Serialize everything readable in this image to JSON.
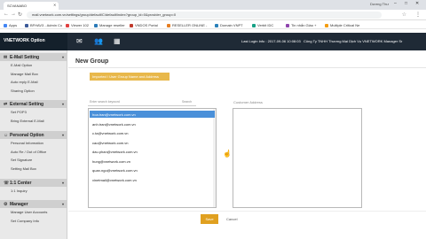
{
  "browser": {
    "tab_title": "SCVANABO",
    "tab_close": "✕",
    "profile_name": "Dương Thư",
    "url": "mail.vnetwork.com.vn/settings/group/default/C/default/index?group_id=0&provider_group=0",
    "bookmarks": [
      {
        "label": "Apps",
        "color": "#4285f4"
      },
      {
        "label": "BFHAV3 - Admin Cu",
        "color": "#3b5998"
      },
      {
        "label": "Viewer 102",
        "color": "#e04040"
      },
      {
        "label": "Manage reseller",
        "color": "#2a7ab8"
      },
      {
        "label": "VNDOS Portal",
        "color": "#c0392b"
      },
      {
        "label": "RESELLER ONLINE -",
        "color": "#e67e22"
      },
      {
        "label": "Domain VNPT",
        "color": "#2980b9"
      },
      {
        "label": "Verbit IDC",
        "color": "#16a085"
      },
      {
        "label": "Tin nhắn Giáo +",
        "color": "#8e44ad"
      },
      {
        "label": "Multiple Critical Ne",
        "color": "#f39c12"
      }
    ]
  },
  "header": {
    "logo": "VNETWORK Option",
    "user_line": "Last Login Info : 2017-09-06 10:08:03",
    "company": "Công Ty TNHH Thương Mại Dịch Vụ VNETWORK Manager Sr"
  },
  "sidebar": {
    "sections": [
      {
        "label": "E-Mail Setting",
        "items": [
          "E-Mail Option",
          "Manage Mail Box",
          "Auto reply E-Mail",
          "Sharing Option"
        ]
      },
      {
        "label": "External Setting",
        "items": [
          "Set POP3",
          "Bring External E-Mail"
        ]
      },
      {
        "label": "Personal Option",
        "items": [
          "Personal Information",
          "Auto Re / Out of Office",
          "Set Signature",
          "Setting Mail Box"
        ]
      },
      {
        "label": "1:1 Center",
        "items": [
          "1:1 Inquiry"
        ]
      },
      {
        "label": "Manager",
        "items": [
          "Manage User Accounts",
          "Set Company Info"
        ]
      }
    ]
  },
  "main": {
    "title": "New Group",
    "import_button": "Imported / User Group Name and Address",
    "search_placeholder": "Enter search keyword",
    "search_button": "Search",
    "emails": [
      "hoa.tran@vnetwork.com.vn",
      "anh.tran@vnetwork.com.vn",
      "c.ta@vnetwork.com.vn",
      "cao@vnetwork.com.vn",
      "dau.phan@vnetwork.com.vn",
      "hung@vnetwork.com.vn",
      "quan.ngo@vnetwork.com.vn",
      "vinetmail@vnetwork.com.vn"
    ],
    "selected_index": 0,
    "customer_label": "Customer Address",
    "save_button": "Save",
    "cancel_button": "Cancel"
  }
}
